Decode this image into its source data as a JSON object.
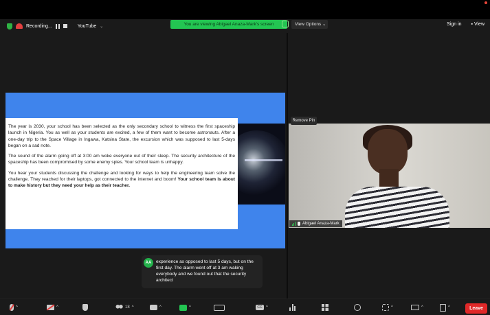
{
  "top_bar": {
    "recording_label": "Recording...",
    "app_label": "YouTube",
    "share_banner": "You are viewing Abigael Anaza-Mark's screen",
    "view_options_label": "View Options",
    "sign_in_label": "Sign in",
    "view_label": "View"
  },
  "shared_document": {
    "paragraph_1": "The year is 2030, your school has been selected as the only secondary school to witness the first spaceship launch in Nigeria. You as well as your students are excited, a few of them want to become astronauts. After a one-day trip to the Space Village in Ingawa, Katsina State, the excursion which was supposed to last 5-days began on a sad note.",
    "paragraph_2": "The sound of the alarm going off at 3:00 am woke everyone out of their sleep. The security architecture of the spaceship has been compromised by some enemy spies. Your school team is unhappy.",
    "paragraph_3_normal": "You hear your students discussing the challenge and looking for ways to help the engineering team solve the challenge. They reached for their laptops, got connected to the internet and boom! ",
    "paragraph_3_bold": "Your school team is about to make history but they need your help as their teacher."
  },
  "video_tile": {
    "remove_pin_label": "Remove Pin",
    "participant_name": "Abigael Anaza-Mark"
  },
  "caption": {
    "avatar_initials": "AA",
    "text": "experience as opposed to last 5 days, but on the first day. The alarm went off at 3 am waking everybody and we found out that the security architect"
  },
  "toolbar": {
    "participants_count": "18",
    "cc_label": "CC",
    "leave_label": "Leave"
  },
  "colors": {
    "share_banner": "#23c552",
    "slide_band": "#3f84ec",
    "leave_button": "#e02828",
    "recording": "#e23f3f"
  }
}
